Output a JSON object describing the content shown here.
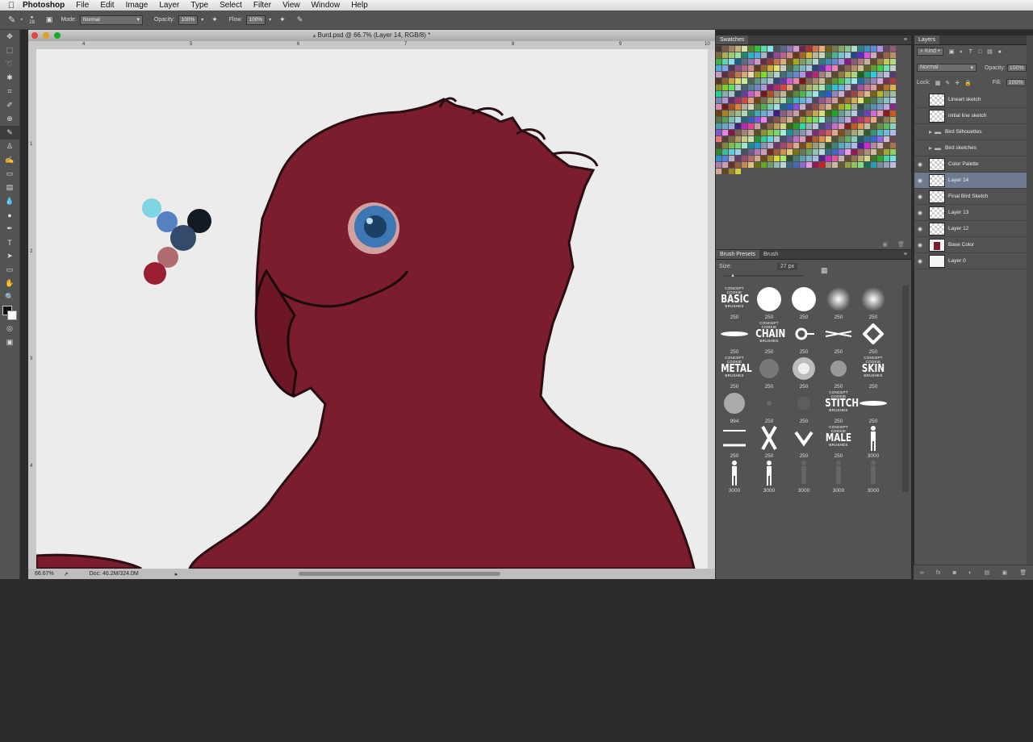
{
  "menubar": {
    "apple": "",
    "app": "Photoshop",
    "items": [
      "File",
      "Edit",
      "Image",
      "Layer",
      "Type",
      "Select",
      "Filter",
      "View",
      "Window",
      "Help"
    ]
  },
  "options": {
    "brush_size": "28",
    "mode_label": "Mode:",
    "mode_value": "Normal",
    "opacity_label": "Opacity:",
    "opacity_value": "100%",
    "flow_label": "Flow:",
    "flow_value": "100%"
  },
  "document": {
    "title": "Burd.psd @ 66.7% (Layer 14, RGB/8) *",
    "ruler_top": [
      "4",
      "5",
      "6",
      "7",
      "8",
      "9",
      "10"
    ],
    "ruler_left": [
      "1",
      "2",
      "3",
      "4"
    ],
    "zoom": "66.67%",
    "doc_info": "Doc: 46.2M/324.0M"
  },
  "colors": {
    "bird_red": "#7b1d2c",
    "canvas_bg": "#ececec",
    "selected_layer": "#6f7b93"
  },
  "swatches": {
    "tab": "Swatches"
  },
  "brushes": {
    "tabs": [
      "Brush Presets",
      "Brush"
    ],
    "size_label": "Size:",
    "size_value": "27 px",
    "logo_small": "CONCEPT COOKIE",
    "logo_brushes": "BRUSHES",
    "logos": [
      "BASIC",
      "CHAIN",
      "METAL",
      "SKIN",
      "STITCH",
      "MALE"
    ],
    "counts": [
      "250",
      "250",
      "250",
      "250",
      "250",
      "250",
      "250",
      "250",
      "250",
      "250",
      "250",
      "250",
      "250",
      "250",
      "250",
      "994",
      "250",
      "250",
      "250",
      "250",
      "250",
      "250",
      "250",
      "250",
      "3000",
      "3000",
      "3000",
      "3000",
      "3000",
      "3000"
    ]
  },
  "layers": {
    "tab": "Layers",
    "kind_label": "Kind",
    "blend_mode": "Normal",
    "opacity_label": "Opacity:",
    "opacity_value": "100%",
    "lock_label": "Lock:",
    "fill_label": "Fill:",
    "fill_value": "100%",
    "items": [
      {
        "name": "Lineart sketch",
        "visible": false,
        "type": "layer"
      },
      {
        "name": "initial line sketch",
        "visible": false,
        "type": "layer"
      },
      {
        "name": "Bird Silhouettes",
        "visible": false,
        "type": "group"
      },
      {
        "name": "Bird sketches",
        "visible": false,
        "type": "group"
      },
      {
        "name": "Color Palette",
        "visible": true,
        "type": "layer"
      },
      {
        "name": "Layer 14",
        "visible": true,
        "type": "layer",
        "selected": true
      },
      {
        "name": "Final Bird Sketch",
        "visible": true,
        "type": "layer"
      },
      {
        "name": "Layer 13",
        "visible": true,
        "type": "layer"
      },
      {
        "name": "Layer 12",
        "visible": true,
        "type": "layer"
      },
      {
        "name": "Base Color",
        "visible": true,
        "type": "layer"
      },
      {
        "name": "Layer 0",
        "visible": true,
        "type": "layer"
      }
    ]
  }
}
